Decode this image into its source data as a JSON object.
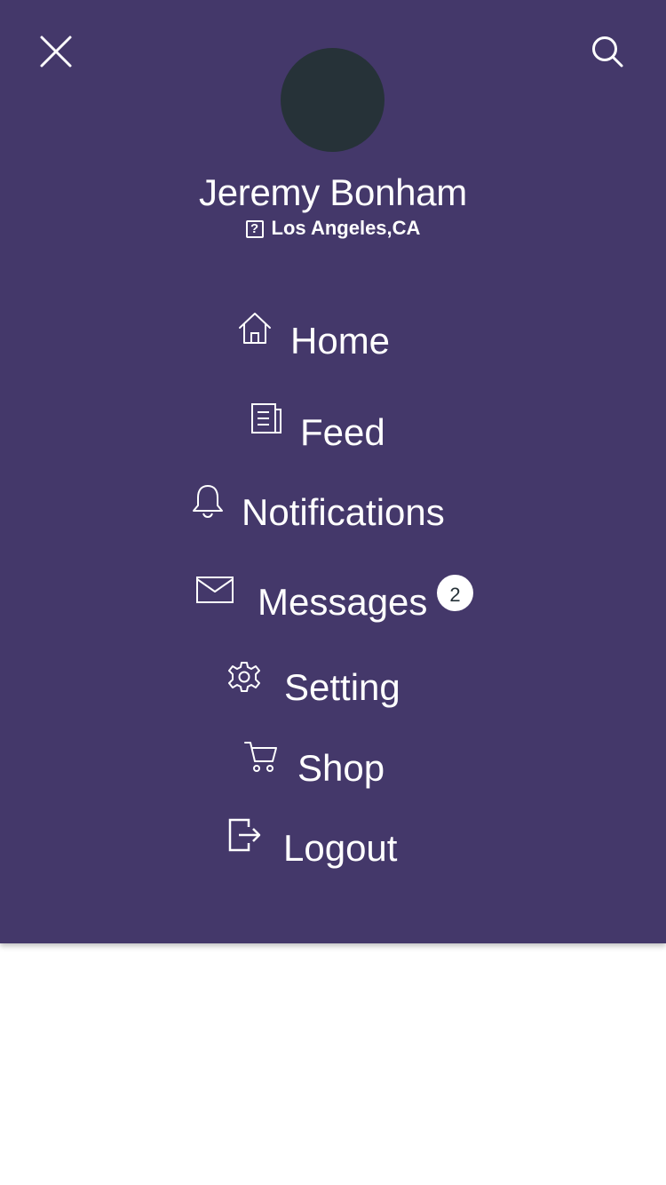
{
  "header": {
    "close_icon": "close-icon",
    "search_icon": "search-icon"
  },
  "profile": {
    "avatar_color": "#263238",
    "name": "Jeremy Bonham",
    "location_icon": "question-box-icon",
    "location_icon_glyph": "?",
    "location": "Los Angeles,CA"
  },
  "menu": {
    "items": [
      {
        "label": "Home",
        "icon": "home-icon"
      },
      {
        "label": "Feed",
        "icon": "newspaper-icon"
      },
      {
        "label": "Notifications",
        "icon": "bell-icon"
      },
      {
        "label": "Messages",
        "icon": "envelope-icon",
        "badge": "2"
      },
      {
        "label": "Setting",
        "icon": "gear-icon"
      },
      {
        "label": "Shop",
        "icon": "cart-icon"
      },
      {
        "label": "Logout",
        "icon": "logout-icon"
      }
    ]
  },
  "colors": {
    "panel_background": "#44386a",
    "text": "#ffffff",
    "page_background": "#ffffff",
    "badge_text": "#263238"
  }
}
